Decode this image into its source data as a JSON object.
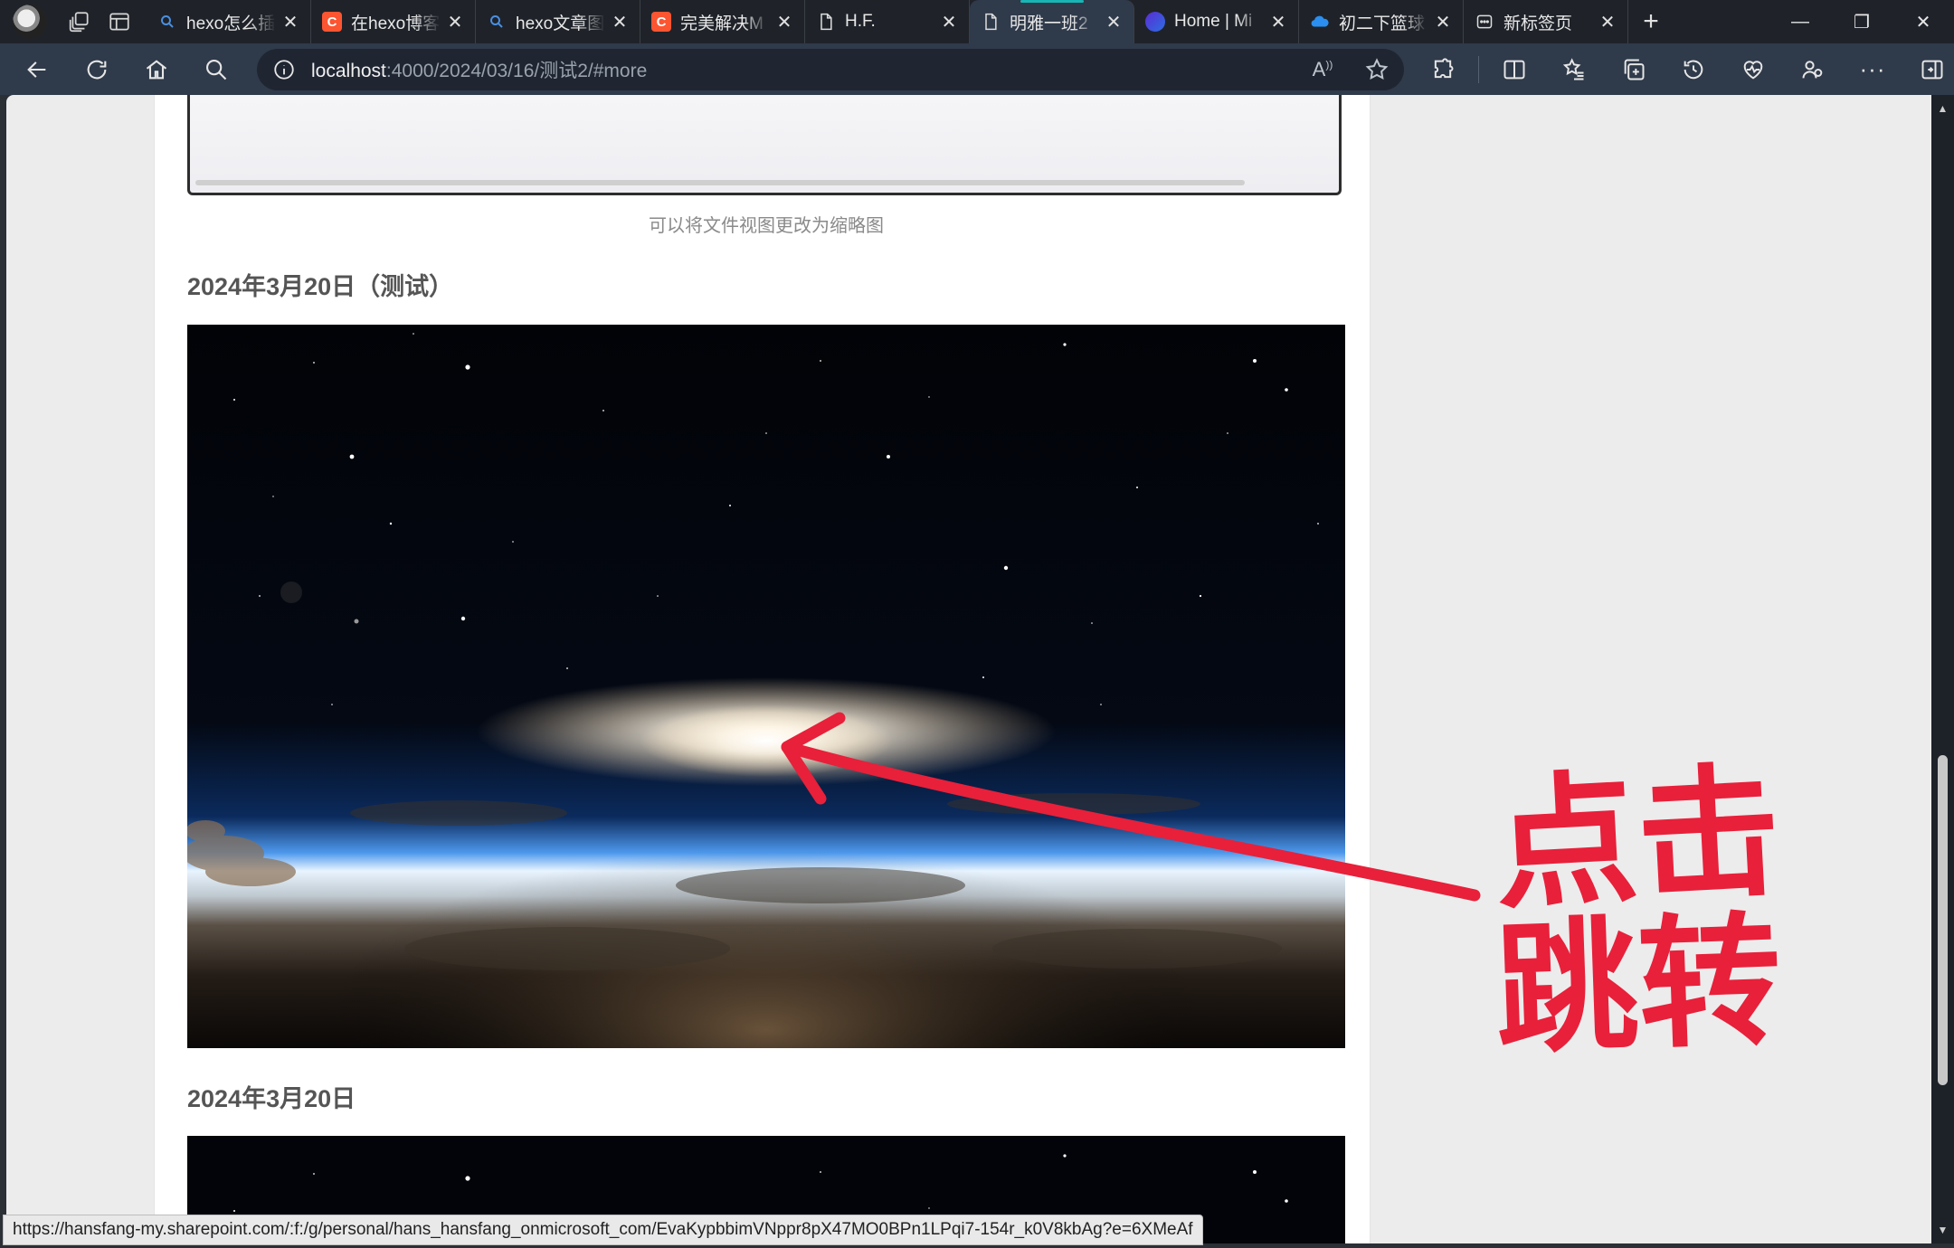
{
  "browser": {
    "tabs": [
      {
        "favicon": "search-icon",
        "title": "hexo怎么插",
        "active": false
      },
      {
        "favicon": "csdn-icon",
        "title": "在hexo博客",
        "active": false
      },
      {
        "favicon": "search-icon",
        "title": "hexo文章图",
        "active": false
      },
      {
        "favicon": "csdn-icon",
        "title": "完美解决M",
        "active": false
      },
      {
        "favicon": "page-icon",
        "title": "H.F.",
        "active": false
      },
      {
        "favicon": "page-icon",
        "title": "明雅一班2",
        "active": true
      },
      {
        "favicon": "copilot-icon",
        "title": "Home | Mi",
        "active": false
      },
      {
        "favicon": "onedrive-icon",
        "title": "初二下篮球",
        "active": false
      },
      {
        "favicon": "newtab-icon",
        "title": "新标签页",
        "active": false
      }
    ],
    "address": {
      "host": "localhost",
      "path": ":4000/2024/03/16/测试2/#more"
    }
  },
  "article": {
    "caption": "可以将文件视图更改为缩略图",
    "heading1": "2024年3月20日（测试）",
    "heading2": "2024年3月20日"
  },
  "annotation": {
    "line1": "点击",
    "line2": "跳转",
    "color": "#e8203a"
  },
  "statusbar": {
    "url": "https://hansfang-my.sharepoint.com/:f:/g/personal/hans_hansfang_onmicrosoft_com/EvaKypbbimVNppr8pX47MO0BPn1LPqi7-154r_k0V8kbAg?e=6XMeAf"
  },
  "colors": {
    "tab_active_bg": "#2f3a4a",
    "tab_strip_bg": "#1f2329",
    "accent": "#18b5b5"
  }
}
